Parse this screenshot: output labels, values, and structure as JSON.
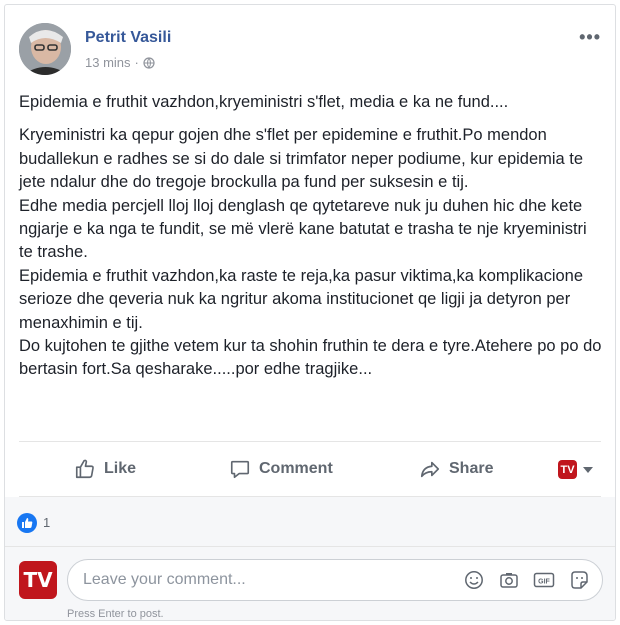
{
  "post": {
    "author": "Petrit Vasili",
    "time": "13 mins",
    "separator": "·",
    "more_label": "•••",
    "lead": "Epidemia e fruthit vazhdon,kryeministri s'flet, media e ka ne fund....",
    "paragraphs": [
      "Kryeministri ka qepur gojen dhe s'flet per epidemine e fruthit.Po mendon budallekun e radhes se si do dale si trimfator neper podiume, kur epidemia te jete ndalur dhe do tregoje brockulla pa fund per suksesin e tij.",
      "Edhe media percjell lloj lloj denglash qe qytetareve nuk ju duhen hic dhe kete ngjarje e ka nga te fundit, se më vlerë kane batutat e trasha te nje kryeministri te trashe.",
      "Epidemia e fruthit vazhdon,ka raste te reja,ka pasur viktima,ka komplikacione serioze dhe qeveria nuk ka ngritur akoma institucionet qe ligji ja detyron per menaxhimin e tij.",
      "Do kujtohen te gjithe vetem kur ta shohin fruthin te dera e tyre.Atehere po po do bertasin fort.Sa qesharake.....por edhe tragjike..."
    ]
  },
  "actions": {
    "like": "Like",
    "comment": "Comment",
    "share": "Share",
    "page_badge": "TV"
  },
  "reactions": {
    "count": "1"
  },
  "composer": {
    "avatar_text": "TV",
    "placeholder": "Leave your comment...",
    "hint": "Press Enter to post.",
    "gif_label": "GIF"
  },
  "colors": {
    "author": "#365899",
    "brand_red": "#c0161d",
    "like_blue": "#1877f2",
    "muted": "#606770"
  },
  "icons": [
    "globe-icon",
    "like-icon",
    "comment-icon",
    "share-icon",
    "emoji-icon",
    "camera-icon",
    "gif-icon",
    "sticker-icon"
  ]
}
